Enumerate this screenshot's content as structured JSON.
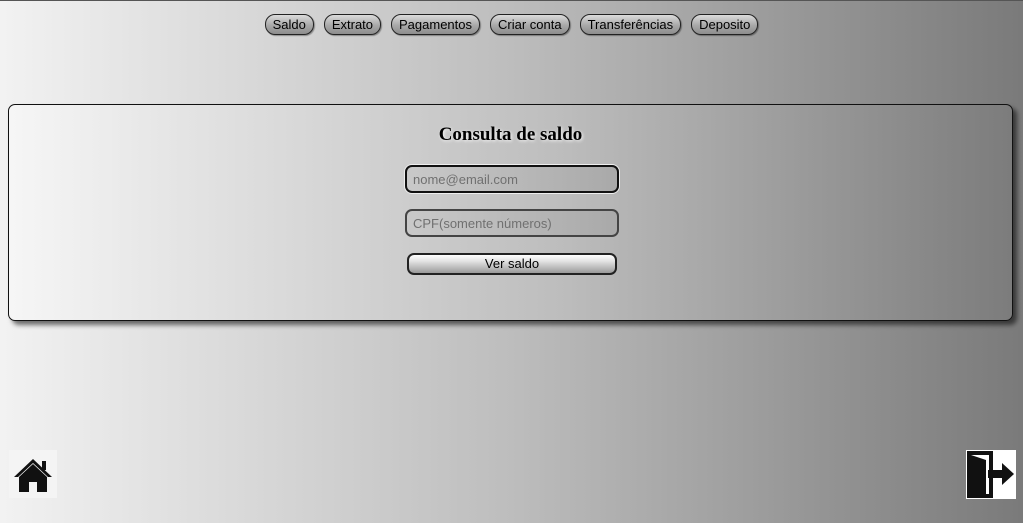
{
  "nav": {
    "items": [
      {
        "label": "Saldo"
      },
      {
        "label": "Extrato"
      },
      {
        "label": "Pagamentos"
      },
      {
        "label": "Criar conta"
      },
      {
        "label": "Transferências"
      },
      {
        "label": "Deposito"
      }
    ]
  },
  "balance_form": {
    "title": "Consulta de saldo",
    "email": {
      "value": "",
      "placeholder": "nome@email.com"
    },
    "cpf": {
      "value": "",
      "placeholder": "CPF(somente números)"
    },
    "submit_label": "Ver saldo"
  },
  "footer": {
    "home_icon": "home-icon",
    "exit_icon": "exit-door-icon"
  },
  "colors": {
    "background_light": "#f2f2f2",
    "background_dark": "#7a7a7a",
    "border": "#222222"
  }
}
